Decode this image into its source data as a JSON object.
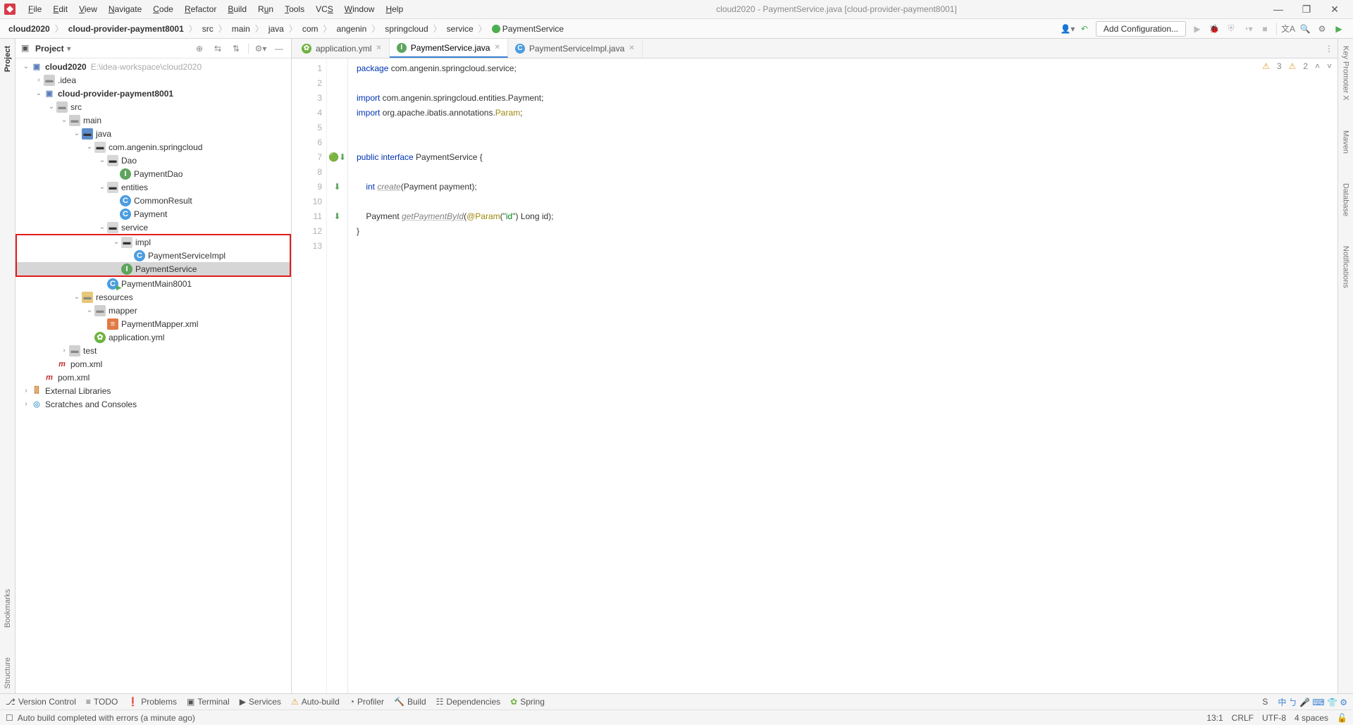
{
  "menu": {
    "items": [
      "File",
      "Edit",
      "View",
      "Navigate",
      "Code",
      "Refactor",
      "Build",
      "Run",
      "Tools",
      "VCS",
      "Window",
      "Help"
    ]
  },
  "window_title": "cloud2020 - PaymentService.java [cloud-provider-payment8001]",
  "breadcrumb": [
    "cloud2020",
    "cloud-provider-payment8001",
    "src",
    "main",
    "java",
    "com",
    "angenin",
    "springcloud",
    "service",
    "PaymentService"
  ],
  "add_config": "Add Configuration...",
  "project_label": "Project",
  "tree": {
    "root": "cloud2020",
    "root_hint": "E:\\idea-workspace\\cloud2020",
    "idea": ".idea",
    "module": "cloud-provider-payment8001",
    "src": "src",
    "main": "main",
    "java": "java",
    "pkg": "com.angenin.springcloud",
    "dao": "Dao",
    "paymentDao": "PaymentDao",
    "entities": "entities",
    "commonResult": "CommonResult",
    "payment": "Payment",
    "service": "service",
    "impl": "impl",
    "paymentServiceImpl": "PaymentServiceImpl",
    "paymentService": "PaymentService",
    "paymentMain": "PaymentMain8001",
    "resources": "resources",
    "mapper": "mapper",
    "paymentMapperXml": "PaymentMapper.xml",
    "appYml": "application.yml",
    "test": "test",
    "pom": "pom.xml",
    "extLib": "External Libraries",
    "scratches": "Scratches and Consoles"
  },
  "tabs": {
    "t1": "application.yml",
    "t2": "PaymentService.java",
    "t3": "PaymentServiceImpl.java"
  },
  "code": {
    "l1a": "package",
    "l1b": " com.angenin.springcloud.service;",
    "l3a": "import",
    "l3b": " com.angenin.springcloud.entities.Payment;",
    "l4a": "import",
    "l4b": " org.apache.ibatis.annotations.",
    "l4c": "Param",
    "l4d": ";",
    "l7a": "public interface ",
    "l7b": "PaymentService {",
    "l9a": "    int ",
    "l9b": "create",
    "l9c": "(Payment payment);",
    "l11a": "    Payment ",
    "l11b": "getPaymentById",
    "l11c": "(",
    "l11d": "@Param",
    "l11e": "(",
    "l11f": "\"id\"",
    "l11g": ") Long id);",
    "l12": "}"
  },
  "inspection": {
    "errors": "3",
    "warnings": "2"
  },
  "bottom": {
    "vc": "Version Control",
    "todo": "TODO",
    "problems": "Problems",
    "terminal": "Terminal",
    "services": "Services",
    "autobuild": "Auto-build",
    "profiler": "Profiler",
    "build": "Build",
    "deps": "Dependencies",
    "spring": "Spring"
  },
  "right_tabs": {
    "keypromoter": "Key Promoter X",
    "maven": "Maven",
    "database": "Database",
    "notifications": "Notifications"
  },
  "left_tabs": {
    "project": "Project",
    "bookmarks": "Bookmarks",
    "structure": "Structure"
  },
  "status": {
    "msg": "Auto build completed with errors (a minute ago)",
    "pos": "13:1",
    "crlf": "CRLF",
    "enc": "UTF-8",
    "indent": "4 spaces"
  }
}
